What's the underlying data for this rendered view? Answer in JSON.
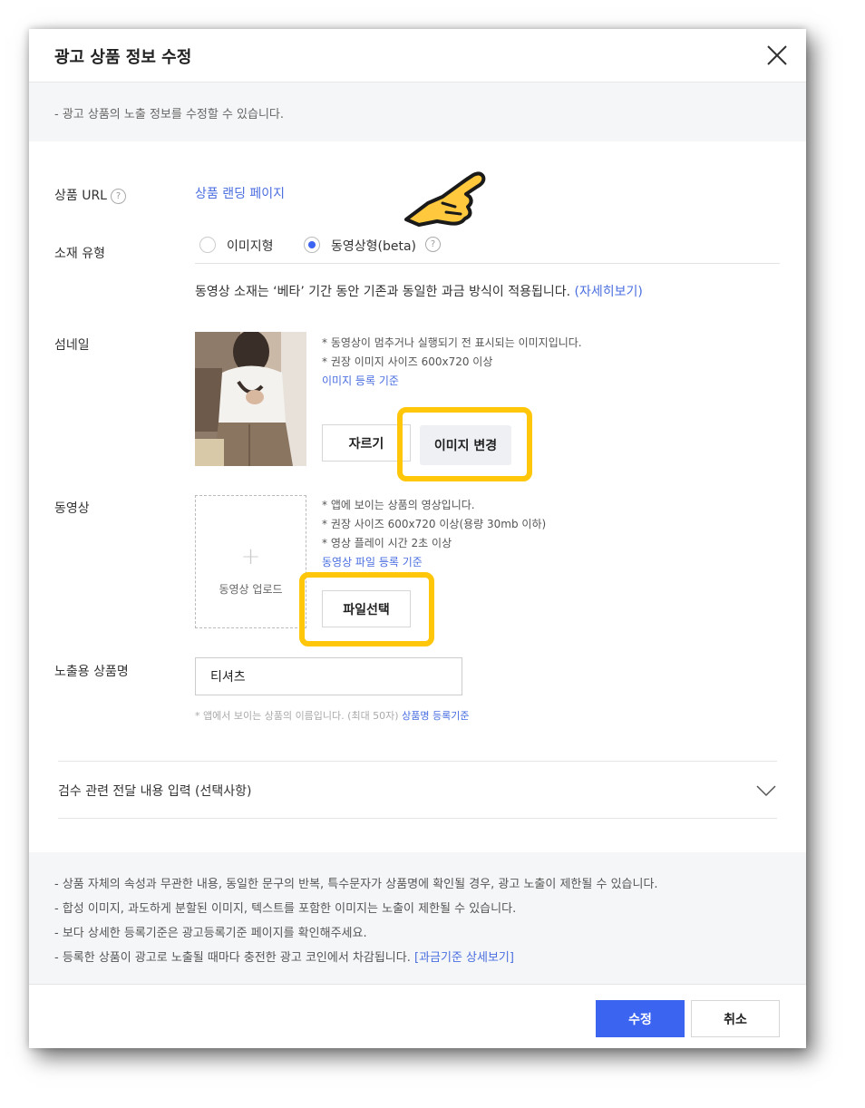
{
  "modal": {
    "title": "광고 상품 정보 수정",
    "notice": "- 광고 상품의 노출 정보를 수정할 수 있습니다."
  },
  "url_field": {
    "label": "상품 URL",
    "help": "?",
    "link": "상품 랜딩 페이지"
  },
  "type_field": {
    "label": "소재 유형",
    "options": [
      {
        "label": "이미지형",
        "selected": false
      },
      {
        "label": "동영상형(beta)",
        "selected": true
      }
    ],
    "help": "?",
    "notice": "동영상 소재는 ‘베타’ 기간 동안 기존과 동일한 과금 방식이 적용됩니다.",
    "notice_link": "(자세히보기)"
  },
  "thumbnail": {
    "label": "섬네일",
    "desc1": "* 동영상이 멈추거나 실행되기 전 표시되는 이미지입니다.",
    "desc2": "* 권장 이미지 사이즈 600x720 이상",
    "guide_link": "이미지 등록 기준",
    "crop_button": "자르기",
    "change_button": "이미지 변경"
  },
  "video": {
    "label": "동영상",
    "upload_plus": "+",
    "upload_label": "동영상 업로드",
    "desc1": "* 앱에 보이는 상품의 영상입니다.",
    "desc2": "* 권장 사이즈 600x720 이상(용량 30mb 이하)",
    "desc3": "* 영상 플레이 시간 2초 이상",
    "guide_link": "동영상 파일 등록 기준",
    "file_button": "파일선택"
  },
  "product_name": {
    "label": "노출용 상품명",
    "value": "티셔츠",
    "hint": "* 앱에서 보이는 상품의 이름입니다. (최대 50자)",
    "hint_link": "상품명 등록기준"
  },
  "review": {
    "label": "검수 관련 전달 내용 입력 (선택사항)"
  },
  "footer_notices": [
    "- 상품 자체의 속성과 무관한 내용, 동일한 문구의 반복, 특수문자가 상품명에 확인될 경우, 광고 노출이 제한될 수 있습니다.",
    "- 합성 이미지, 과도하게 분할된 이미지, 텍스트를 포함한 이미지는 노출이 제한될 수 있습니다.",
    "- 보다 상세한 등록기준은 광고등록기준 페이지를 확인해주세요.",
    "- 등록한 상품이 광고로 노출될 때마다 충전한 광고 코인에서 차감됩니다."
  ],
  "footer_link": "[과금기준 상세보기]",
  "buttons": {
    "submit": "수정",
    "cancel": "취소"
  },
  "colors": {
    "accent": "#3b64f0",
    "link": "#4a6ee0",
    "highlight": "#ffc60a"
  }
}
